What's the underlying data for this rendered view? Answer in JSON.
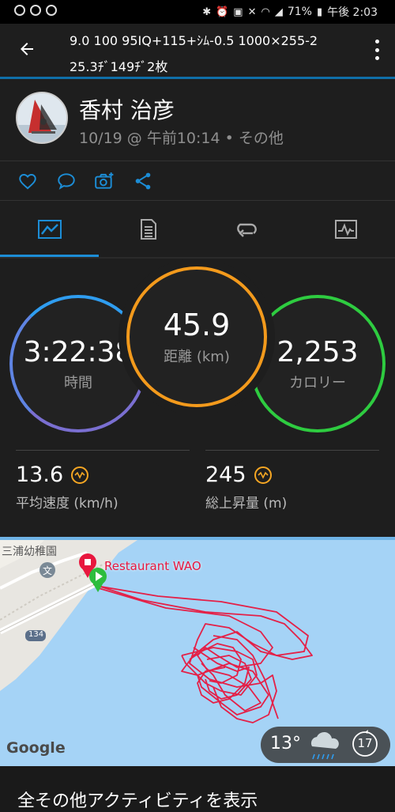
{
  "status_bar": {
    "battery": "71%",
    "time": "午後 2:03",
    "icons": [
      "notification-dot",
      "bluetooth-icon",
      "alarm-icon",
      "nfc-icon",
      "mute-icon",
      "wifi-icon",
      "signal-icon",
      "battery-icon"
    ]
  },
  "app_bar": {
    "title_line1": "9.0 100 95IQ+115+ｼﾑ-0.5 1000×255-2",
    "title_line2": "25.3ﾁﾞ149ﾁﾞ2枚",
    "back_icon": "back-arrow-icon",
    "menu_icon": "more-vert-icon"
  },
  "profile": {
    "name": "香村 治彦",
    "meta": "10/19 @ 午前10:14 • その他"
  },
  "actions": [
    "heart-icon",
    "comment-icon",
    "add-photo-icon",
    "share-icon"
  ],
  "tabs": [
    {
      "icon": "map-summary-icon",
      "active": true
    },
    {
      "icon": "details-icon",
      "active": false
    },
    {
      "icon": "laps-icon",
      "active": false
    },
    {
      "icon": "charts-icon",
      "active": false
    }
  ],
  "stats": {
    "time": {
      "value": "3:22:38",
      "label": "時間",
      "color": "#7a6fd1"
    },
    "distance": {
      "value": "45.9",
      "label": "距離 (km)",
      "color": "#f39a1c"
    },
    "calories": {
      "value": "2,253",
      "label": "カロリー",
      "color": "#2ecc40"
    },
    "avg_speed": {
      "value": "13.6",
      "label": "平均速度 (km/h)"
    },
    "elevation": {
      "value": "245",
      "label": "総上昇量 (m)"
    }
  },
  "map": {
    "place_label": "三浦幼稚園",
    "restaurant_label": "Restaurant WAO",
    "route_number": "134",
    "google_label": "Google",
    "weather_temp": "13°",
    "wind": "17",
    "route_color": "#e8173e"
  },
  "bottom": {
    "link_text": "全その他アクティビティを表示"
  }
}
